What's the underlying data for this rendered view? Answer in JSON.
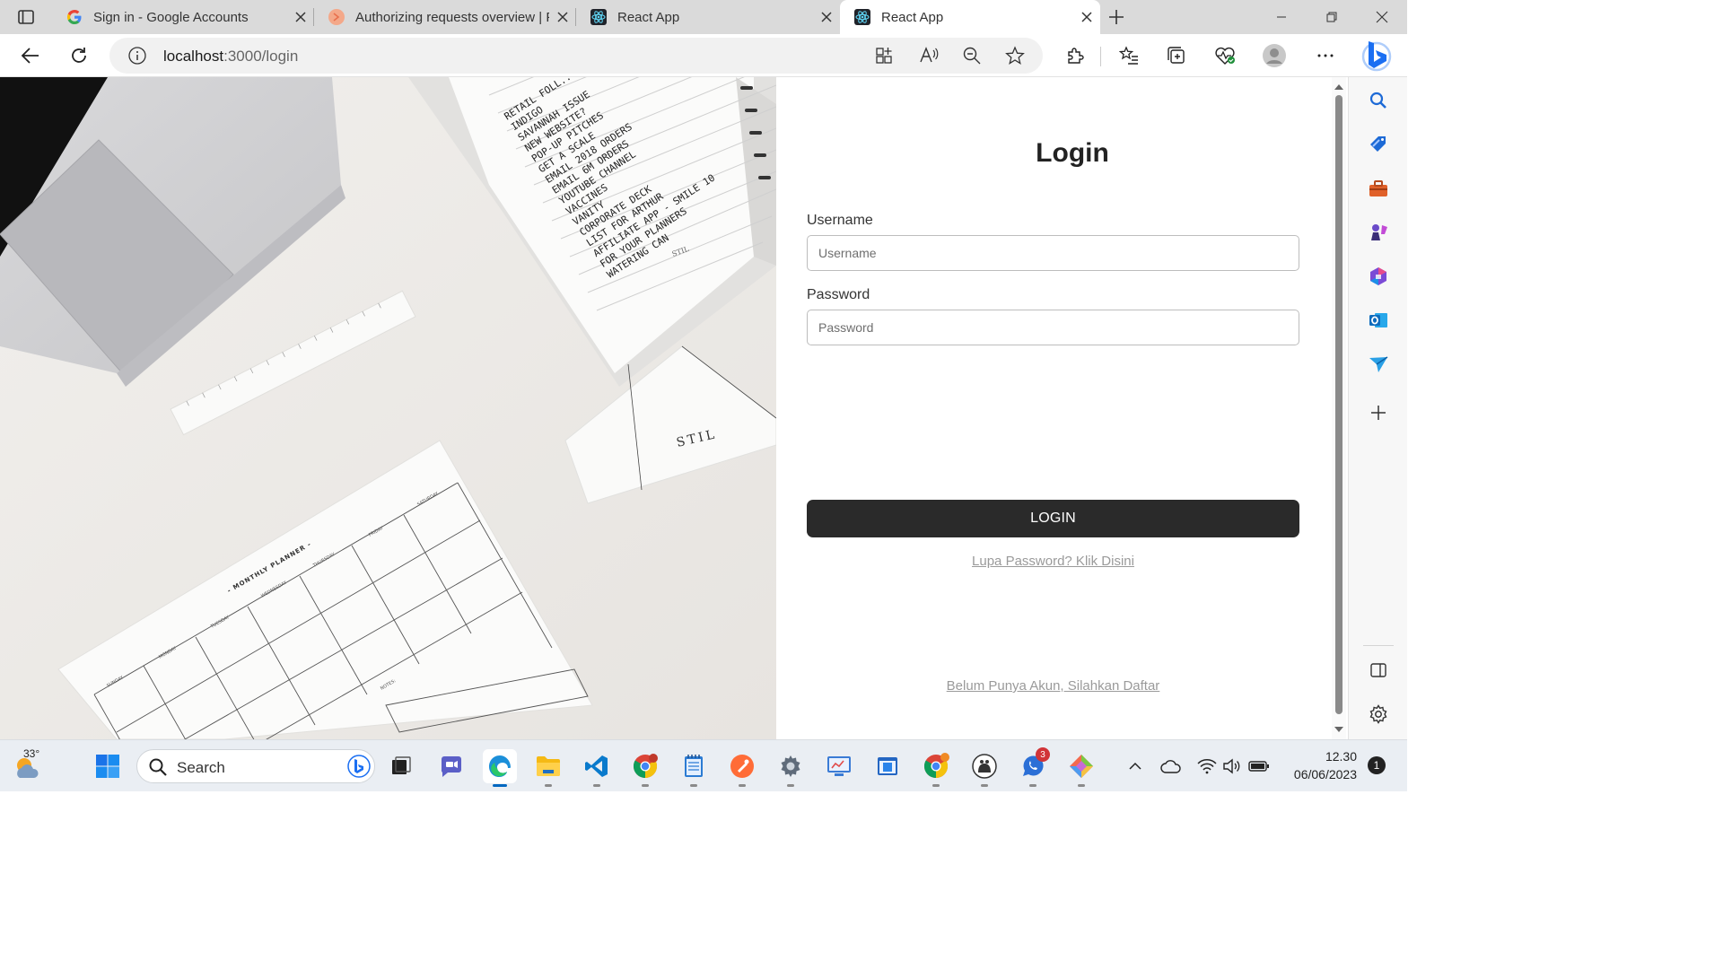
{
  "browser": {
    "tabs": [
      {
        "title": "Sign in - Google Accounts",
        "active": false
      },
      {
        "title": "Authorizing requests overview | F",
        "active": false
      },
      {
        "title": "React App",
        "active": false
      },
      {
        "title": "React App",
        "active": true
      }
    ],
    "url_host": "localhost",
    "url_path": ":3000/login"
  },
  "page": {
    "title": "Login",
    "username_label": "Username",
    "username_placeholder": "Username",
    "username_value": "",
    "password_label": "Password",
    "password_placeholder": "Password",
    "password_value": "",
    "login_button": "LOGIN",
    "forgot_link": "Lupa Password? Klik Disini",
    "register_link": "Belum Punya Akun, Silahkan Daftar"
  },
  "photo": {
    "notebook_lines": [
      "RETAIL FOLL...",
      "INDIGO",
      "SAVANNAH ISSUE",
      "NEW WEBSITE?",
      "POP-UP PITCHES",
      "GET A SCALE",
      "EMAIL 2018 ORDERS",
      "EMAIL 6M ORDERS",
      "YOUTUBE CHANNEL",
      "VACCINES",
      "VANITY",
      "CORPORATE DECK",
      "LIST FOR ARTHUR",
      "AFFILIATE APP - SMILE 10",
      "FOR YOUR PLANNERS",
      "WATERING CAN"
    ],
    "brand": "STIL",
    "planner_title": "- MONTHLY PLANNER -",
    "planner_days": [
      "SUNDAY",
      "MONDAY",
      "TUESDAY",
      "WEDNESDAY",
      "THURSDAY",
      "FRIDAY",
      "SATURDAY"
    ],
    "planner_notes": "NOTES:"
  },
  "taskbar": {
    "weather": "33°",
    "search_label": "Search",
    "time": "12.30",
    "date": "06/06/2023",
    "notifications": "1",
    "badge_a": "3"
  }
}
